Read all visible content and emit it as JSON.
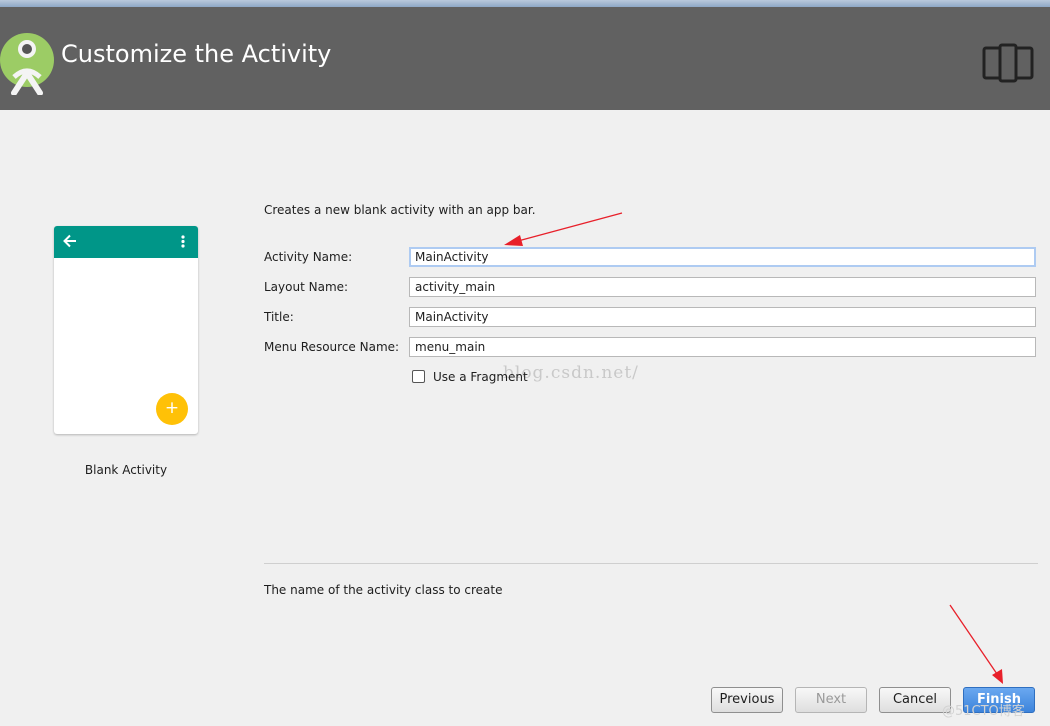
{
  "header": {
    "title": "Customize the Activity"
  },
  "icons": {
    "logo": "android-studio-logo",
    "device": "phone-tablet-icon",
    "back": "arrow-back-icon",
    "overflow": "more-vert-icon",
    "fab": "plus-icon"
  },
  "preview": {
    "caption": "Blank Activity",
    "fab_symbol": "+"
  },
  "form": {
    "description": "Creates a new blank activity with an app bar.",
    "activity_name": {
      "label": "Activity Name:",
      "value": "MainActivity"
    },
    "layout_name": {
      "label": "Layout Name:",
      "value": "activity_main"
    },
    "title": {
      "label": "Title:",
      "value": "MainActivity"
    },
    "menu_resource_name": {
      "label": "Menu Resource Name:",
      "value": "menu_main"
    },
    "use_fragment": {
      "label": "Use a Fragment",
      "checked": false
    }
  },
  "watermark": "blog.csdn.net/",
  "help_text": "The name of the activity class to create",
  "buttons": {
    "previous": "Previous",
    "next": "Next",
    "cancel": "Cancel",
    "finish": "Finish"
  },
  "corner_badge": "@51CTO博客",
  "colors": {
    "header": "#616161",
    "appbar": "#009688",
    "fab": "#ffc107",
    "annotation_arrow": "#e8202a",
    "finish_button": "#4a90e2"
  }
}
